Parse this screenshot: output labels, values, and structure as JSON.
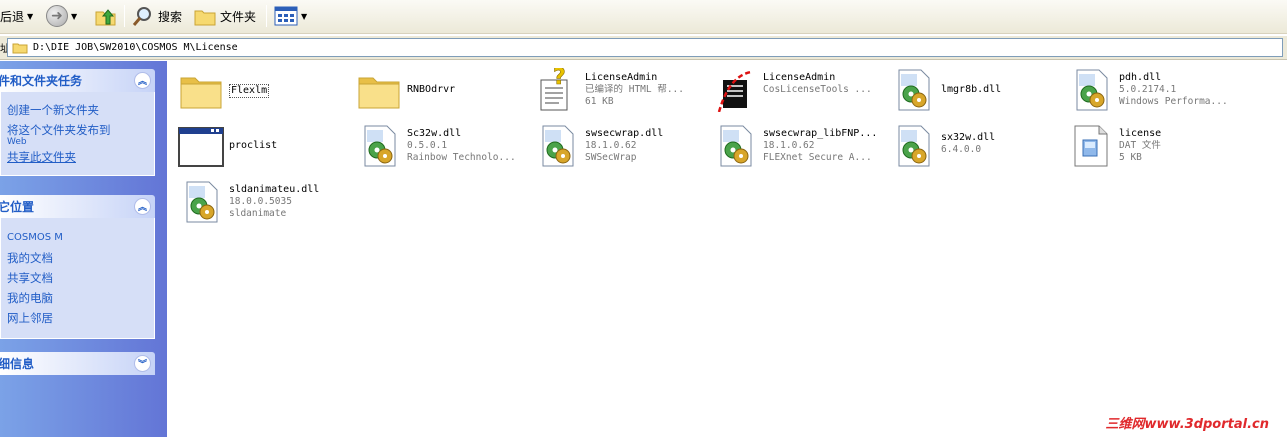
{
  "toolbar": {
    "back_label": "后退",
    "search_label": "搜索",
    "folders_label": "文件夹"
  },
  "address": {
    "prefix": "址",
    "path": "D:\\DIE JOB\\SW2010\\COSMOS M\\License"
  },
  "panes": {
    "tasks": {
      "title": "件和文件夹任务",
      "items": [
        "创建一个新文件夹",
        "将这个文件夹发布到",
        "Web",
        "共享此文件夹"
      ]
    },
    "places": {
      "title": "它位置",
      "items": [
        "COSMOS M",
        "我的文档",
        "共享文档",
        "我的电脑",
        "网上邻居"
      ]
    },
    "details": {
      "title": "细信息"
    }
  },
  "files": [
    {
      "name": "Flexlm",
      "type": "folder"
    },
    {
      "name": "RNBOdrvr",
      "type": "folder"
    },
    {
      "name": "LicenseAdmin",
      "line2": "已编译的 HTML 帮...",
      "line3": "61 KB",
      "type": "chm"
    },
    {
      "name": "LicenseAdmin",
      "line2": "CosLicenseTools ...",
      "type": "exe"
    },
    {
      "name": "lmgr8b.dll",
      "type": "dll"
    },
    {
      "name": "pdh.dll",
      "line2": "5.0.2174.1",
      "line3": "Windows Performa...",
      "type": "dll"
    },
    {
      "name": "proclist",
      "type": "app"
    },
    {
      "name": "Sc32w.dll",
      "line2": "0.5.0.1",
      "line3": "Rainbow Technolo...",
      "type": "dll"
    },
    {
      "name": "swsecwrap.dll",
      "line2": "18.1.0.62",
      "line3": "SWSecWrap",
      "type": "dll"
    },
    {
      "name": "swsecwrap_libFNP...",
      "line2": "18.1.0.62",
      "line3": "FLEXnet Secure A...",
      "type": "dll"
    },
    {
      "name": "sx32w.dll",
      "line2": "6.4.0.0",
      "type": "dll"
    },
    {
      "name": "license",
      "line2": "DAT 文件",
      "line3": "5 KB",
      "type": "dat"
    },
    {
      "name": "sldanimateu.dll",
      "line2": "18.0.0.5035",
      "line3": "sldanimate",
      "type": "dll"
    }
  ],
  "watermark": "三维网www.3dportal.cn",
  "colors": {
    "task_pane_bg": "#6f8fe0",
    "link": "#215dc6",
    "panel_body": "#d6dff7",
    "folder": "#f6d970"
  }
}
